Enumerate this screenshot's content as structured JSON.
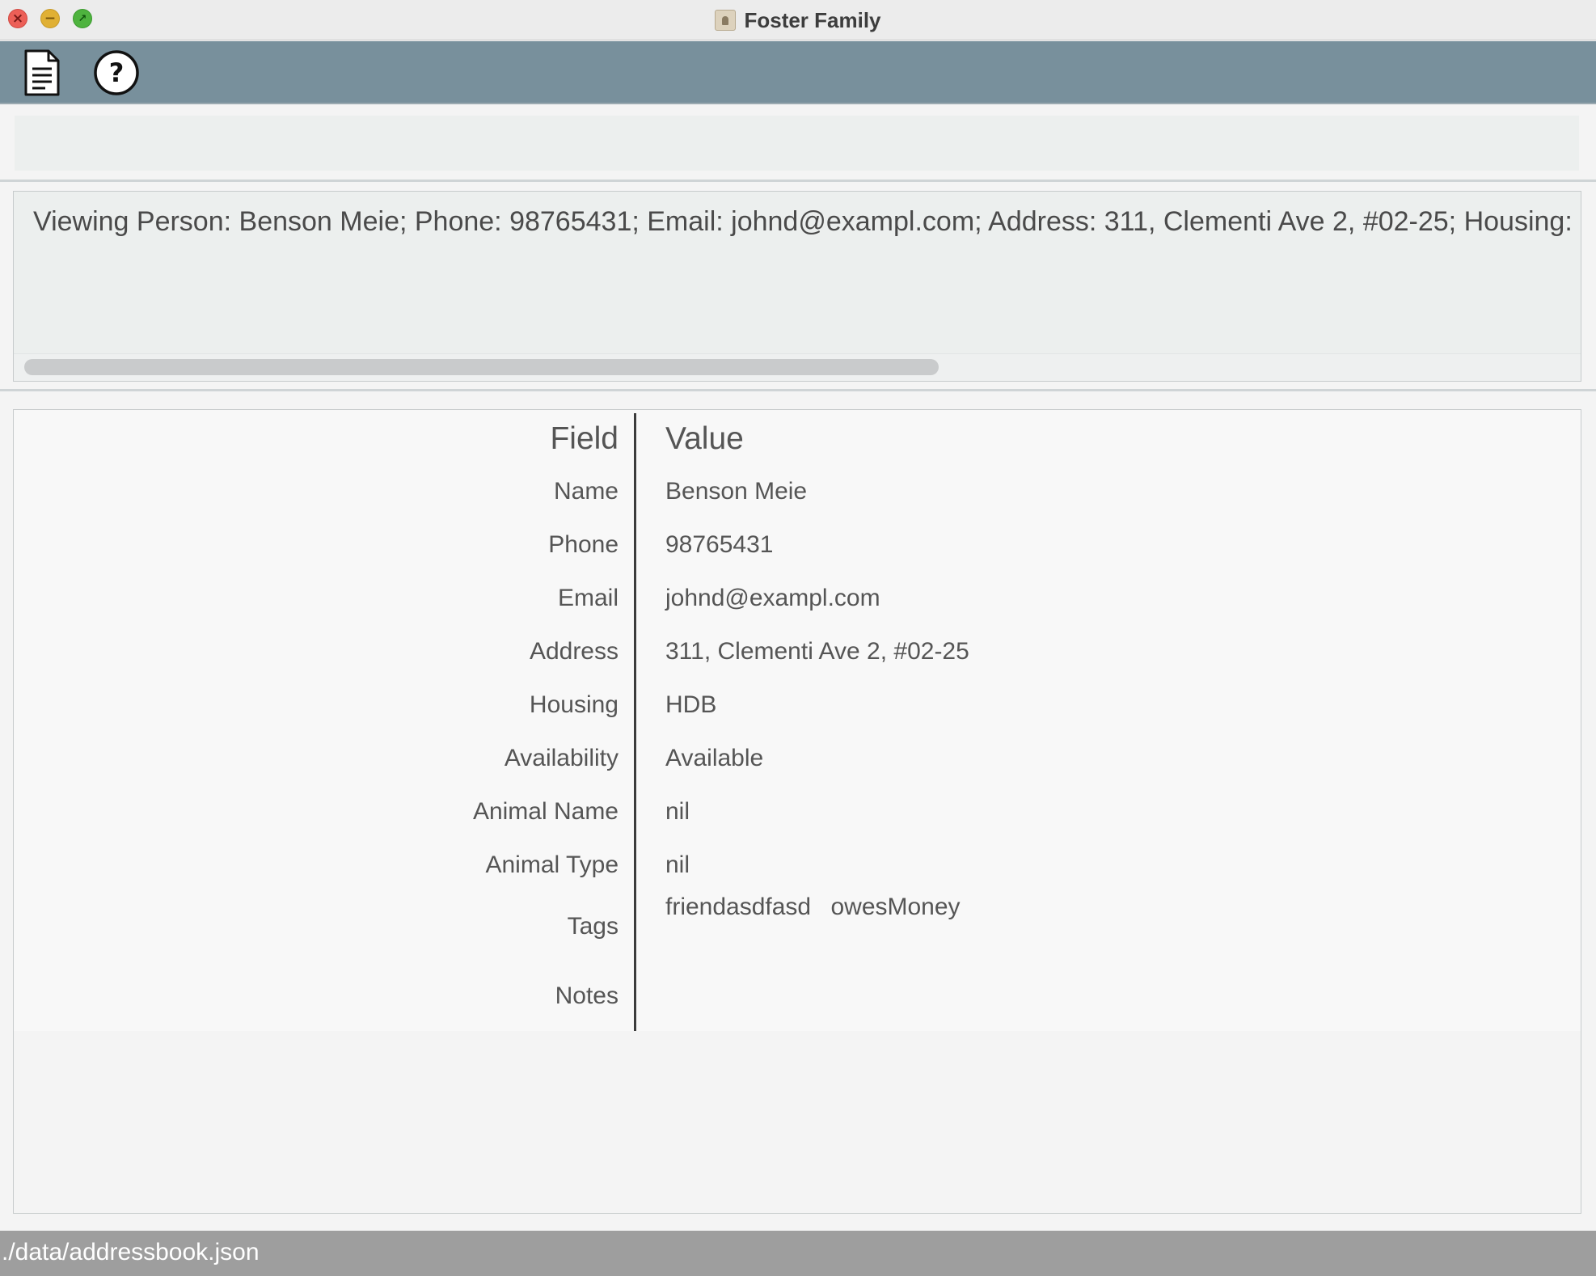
{
  "window": {
    "title": "Foster Family",
    "title_icon": "app-icon"
  },
  "toolbar": {
    "file_icon": "document-icon",
    "help_icon": "help-icon"
  },
  "command": {
    "value": "",
    "placeholder": ""
  },
  "result": {
    "text": "Viewing Person: Benson Meie; Phone: 98765431; Email: johnd@exampl.com; Address: 311, Clementi Ave 2, #02-25; Housing: HDB; Availability: Available; Animal Name: nil; Animal Type: nil; Tags: [friendasdfasd][owesMoney]"
  },
  "details": {
    "header": {
      "field": "Field",
      "value": "Value"
    },
    "rows": [
      {
        "field": "Name",
        "value": "Benson Meie"
      },
      {
        "field": "Phone",
        "value": "98765431"
      },
      {
        "field": "Email",
        "value": "johnd@exampl.com"
      },
      {
        "field": "Address",
        "value": "311, Clementi Ave 2, #02-25"
      },
      {
        "field": "Housing",
        "value": "HDB"
      },
      {
        "field": "Availability",
        "value": "Available"
      },
      {
        "field": "Animal Name",
        "value": "nil"
      },
      {
        "field": "Animal Type",
        "value": "nil"
      }
    ],
    "tags": {
      "field": "Tags",
      "values": [
        "friendasdfasd",
        "owesMoney"
      ]
    },
    "notes": {
      "field": "Notes",
      "value": ""
    }
  },
  "status": {
    "path": "./data/addressbook.json"
  },
  "colors": {
    "toolbar": "#78909c",
    "statusbar": "#9e9e9e",
    "panel": "#ecefee"
  }
}
